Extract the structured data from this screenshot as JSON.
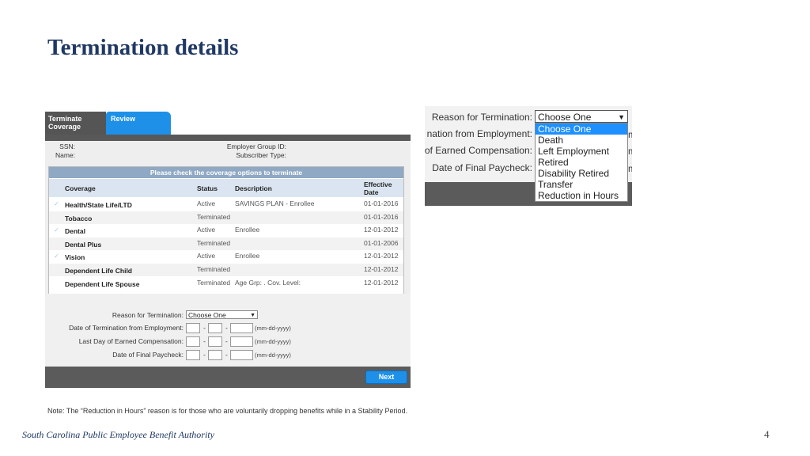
{
  "title": "Termination details",
  "tabs": {
    "terminate": "Terminate Coverage",
    "review": "Review"
  },
  "info": {
    "ssn_label": "SSN:",
    "name_label": "Name:",
    "group_label": "Employer Group ID:",
    "subscriber_label": "Subscriber Type:"
  },
  "grid": {
    "header": "Please check the coverage options to terminate",
    "columns": [
      "Coverage",
      "Status",
      "Description",
      "Effective Date"
    ],
    "rows": [
      {
        "coverage": "Health/State Life/LTD",
        "status": "Active",
        "description": "SAVINGS PLAN - Enrollee",
        "date": "01-01-2016",
        "checked": true
      },
      {
        "coverage": "Tobacco",
        "status": "Terminated",
        "description": "",
        "date": "01-01-2016",
        "checked": false
      },
      {
        "coverage": "Dental",
        "status": "Active",
        "description": "Enrollee",
        "date": "12-01-2012",
        "checked": true
      },
      {
        "coverage": "Dental Plus",
        "status": "Terminated",
        "description": "",
        "date": "01-01-2006",
        "checked": false
      },
      {
        "coverage": "Vision",
        "status": "Active",
        "description": "Enrollee",
        "date": "12-01-2012",
        "checked": true
      },
      {
        "coverage": "Dependent Life Child",
        "status": "Terminated",
        "description": "",
        "date": "12-01-2012",
        "checked": false
      },
      {
        "coverage": "Dependent Life Spouse",
        "status": "Terminated",
        "description": "Age Grp: .    Cov. Level:",
        "date": "12-01-2012",
        "checked": false
      }
    ]
  },
  "form": {
    "reason_label": "Reason for Termination:",
    "reason_value": "Choose One",
    "term_date_label": "Date of Termination from Employment:",
    "earned_label": "Last Day of Earned Compensation:",
    "paycheck_label": "Date of Final Paycheck:",
    "date_hint": "(mm-dd-yyyy)",
    "dash": "-",
    "next": "Next"
  },
  "dropdown": {
    "reason_label": "Reason for Termination:",
    "employment_label": "nation from Employment:",
    "earned_label": "of Earned Compensation:",
    "paycheck_label": "Date of Final Paycheck:",
    "selected": "Choose One",
    "options": [
      "Choose One",
      "Death",
      "Left Employment",
      "Retired",
      "Disability Retired",
      "Transfer",
      "Reduction in Hours"
    ],
    "cut_m": "m"
  },
  "note": "Note: The “Reduction in Hours” reason is for those who are voluntarily dropping benefits while in a Stability Period.",
  "footer": "South Carolina Public Employee Benefit Authority",
  "page_number": "4"
}
